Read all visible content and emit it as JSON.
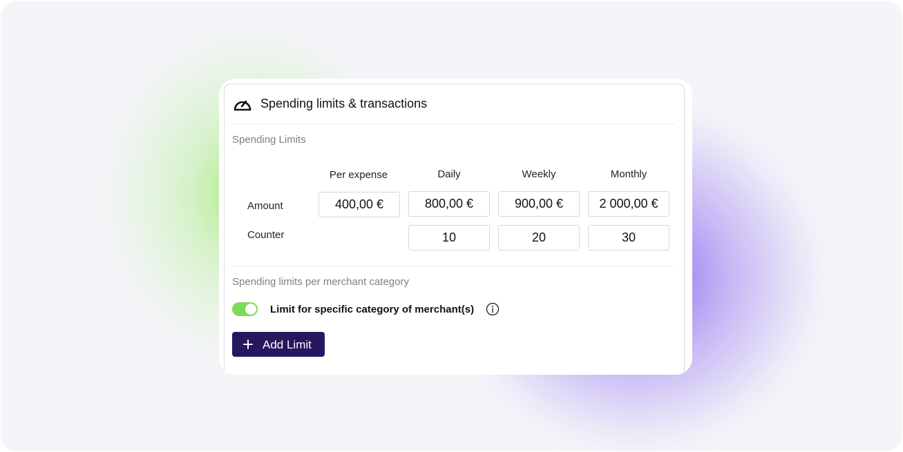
{
  "panel": {
    "title": "Spending limits & transactions",
    "title_icon": "gauge-icon"
  },
  "spending_limits": {
    "section_label": "Spending Limits",
    "columns": [
      "Per expense",
      "Daily",
      "Weekly",
      "Monthly"
    ],
    "rows": {
      "amount": {
        "label": "Amount",
        "values": [
          "400,00 €",
          "800,00 €",
          "900,00 €",
          "2 000,00 €"
        ]
      },
      "counter": {
        "label": "Counter",
        "values": [
          "",
          "10",
          "20",
          "30"
        ]
      }
    }
  },
  "merchant_limits": {
    "section_label": "Spending limits per merchant category",
    "toggle": {
      "label": "Limit for specific category of merchant(s)",
      "enabled": true,
      "color": "#7ed957"
    },
    "info_icon": "info-icon",
    "add_button": {
      "label": "Add Limit",
      "icon": "plus-icon",
      "color": "#27175e"
    }
  }
}
